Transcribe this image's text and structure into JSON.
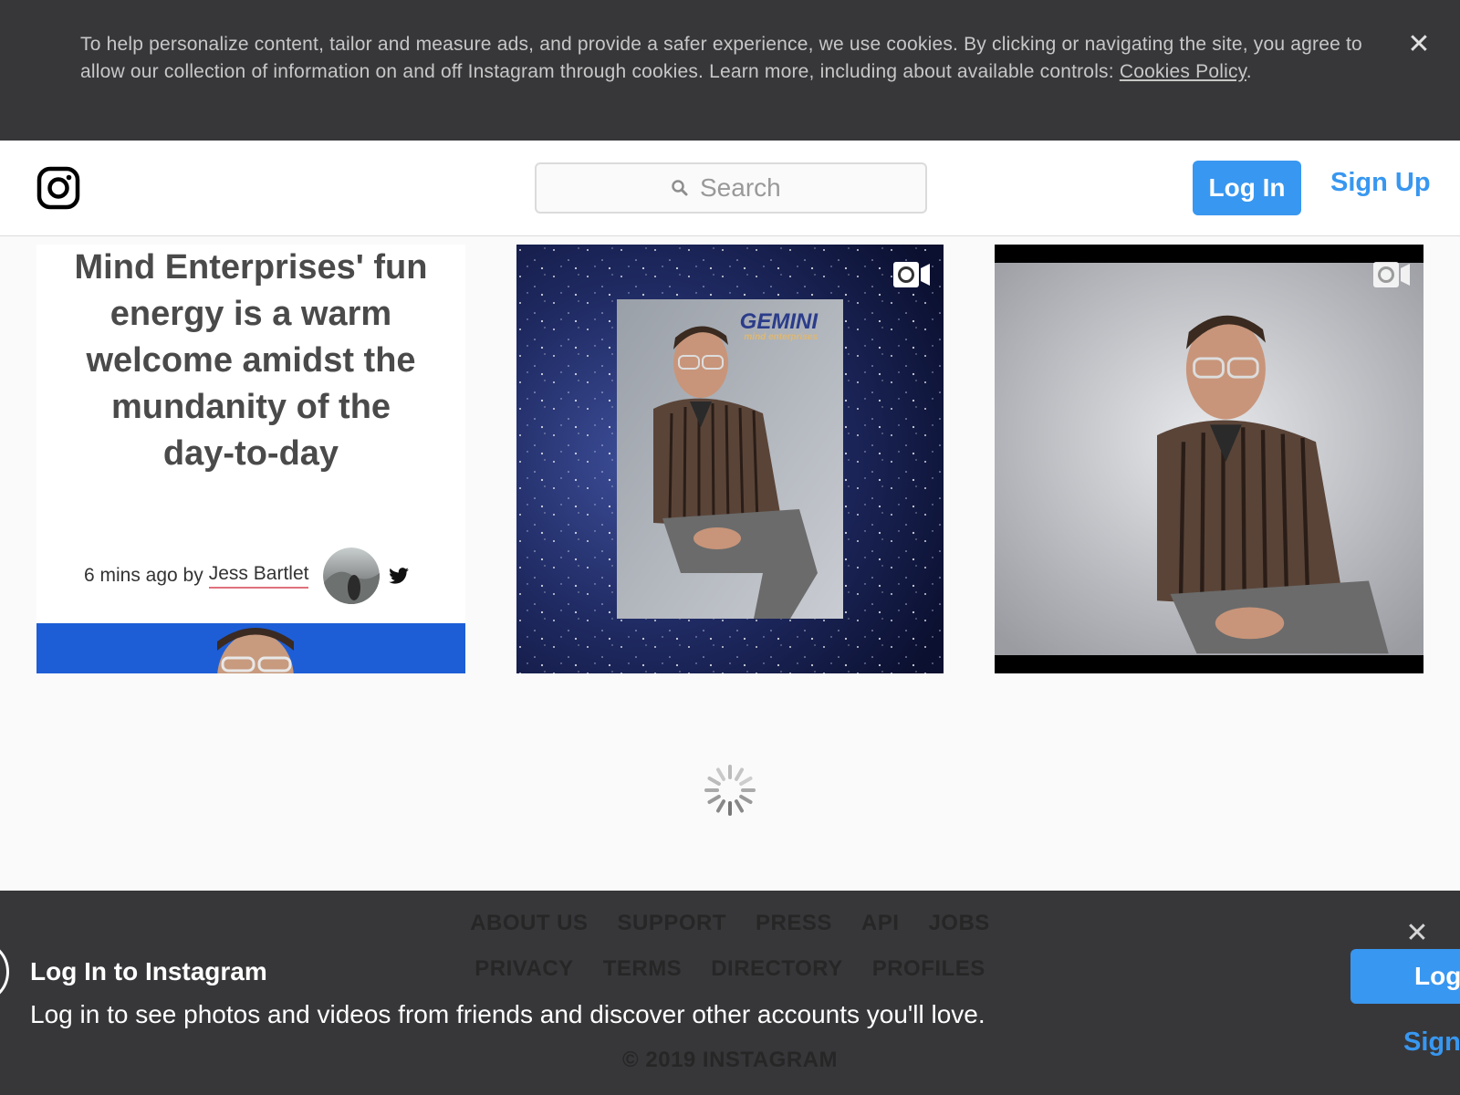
{
  "cookie_banner": {
    "text": "To help personalize content, tailor and measure ads, and provide a safer experience, we use cookies. By clicking or navigating the site, you agree to allow our collection of information on and off Instagram through cookies. Learn more, including about available controls: ",
    "link": "Cookies Policy",
    "period": ".",
    "close_icon": "close-icon"
  },
  "header": {
    "logo_icon": "instagram-logo-icon",
    "search_placeholder": "Search",
    "login_label": "Log In",
    "signup_label": "Sign Up"
  },
  "posts": [
    {
      "kind": "article-screenshot",
      "headline": "Mind Enterprises' fun energy is a warm welcome amidst the mundanity of the day-to-day",
      "meta_prefix": "6 mins ago by",
      "author": "Jess Bartlet",
      "icon": "twitter-icon"
    },
    {
      "kind": "video",
      "overlay_brand": "GEMINI",
      "overlay_sub": "mind enterprises",
      "icon": "video-camera-icon"
    },
    {
      "kind": "video",
      "icon": "video-camera-icon"
    }
  ],
  "footer": {
    "row1": [
      "ABOUT US",
      "SUPPORT",
      "PRESS",
      "API",
      "JOBS"
    ],
    "row2": [
      "PRIVACY",
      "TERMS",
      "DIRECTORY",
      "PROFILES"
    ],
    "copyright": "© 2019 INSTAGRAM"
  },
  "login_prompt": {
    "title": "Log In to Instagram",
    "subtitle": "Log in to see photos and videos from friends and discover other accounts you'll love.",
    "login_label": "Log",
    "signup_label": "Sign",
    "close_icon": "close-icon"
  },
  "colors": {
    "accent": "#3897f0",
    "overlay_dark": "#37373a",
    "background": "#fafafa"
  }
}
